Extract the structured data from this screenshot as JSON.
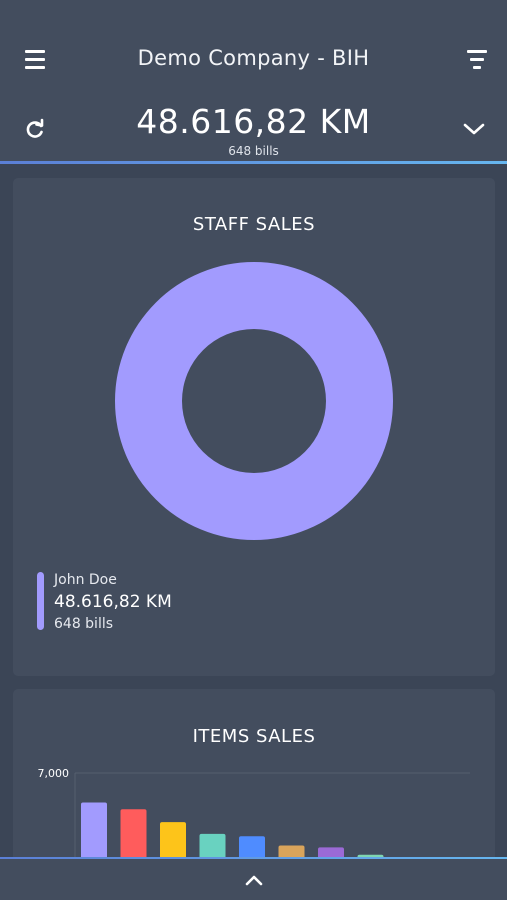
{
  "header": {
    "title": "Demo Company - BIH",
    "total_amount": "48.616,82 KM",
    "total_bills": "648 bills"
  },
  "icons": {
    "menu": "hamburger-menu-icon",
    "filter": "filter-icon",
    "refresh": "refresh-icon",
    "expand": "chevron-down-icon",
    "collapse": "chevron-up-icon"
  },
  "colors": {
    "background": "#3b4556",
    "card": "#434d5e",
    "accent_line_start": "#5b7fd6",
    "accent_line_end": "#66b6ef"
  },
  "staff_sales": {
    "title": "STAFF SALES",
    "chart_data": {
      "type": "pie",
      "slices": [
        {
          "name": "John Doe",
          "value": 48616.82,
          "color": "#a29bfe"
        }
      ]
    },
    "legend": [
      {
        "name": "John Doe",
        "amount": "48.616,82 KM",
        "bills": "648 bills",
        "color": "#a29bfe"
      }
    ]
  },
  "items_sales": {
    "title": "ITEMS SALES",
    "chart_data": {
      "type": "bar",
      "ylim": [
        0,
        7000
      ],
      "y_tick_labels": [
        "7,000"
      ],
      "grid": true,
      "values": [
        4600,
        4050,
        3000,
        2050,
        1850,
        1100,
        950,
        350,
        150
      ],
      "colors": [
        "#a29bfe",
        "#ff5c5c",
        "#fdc41a",
        "#69d2c0",
        "#4f8cff",
        "#d9a45b",
        "#9b6ad6",
        "#7fd6b1",
        "#9aa3b2"
      ]
    }
  }
}
